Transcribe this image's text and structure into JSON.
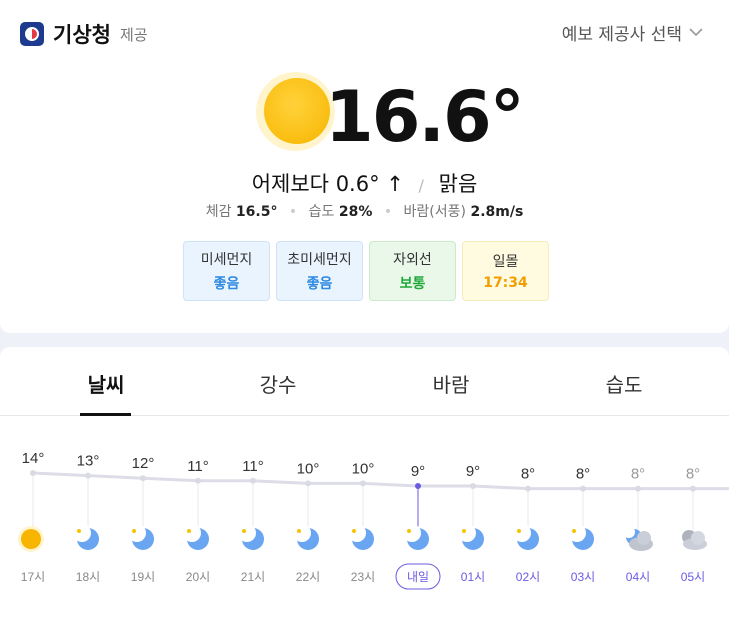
{
  "header": {
    "brand_name": "기상청",
    "brand_sub": "제공",
    "provider_label": "예보 제공사 선택"
  },
  "current": {
    "temperature": "16.6°",
    "compare_prefix": "어제보다",
    "compare_value": "0.6° ↑",
    "condition": "맑음",
    "feels_label": "체감",
    "feels_value": "16.5°",
    "humidity_label": "습도",
    "humidity_value": "28%",
    "wind_label": "바람(서풍)",
    "wind_value": "2.8m/s"
  },
  "badges": [
    {
      "label": "미세먼지",
      "value": "좋음",
      "color": "#2f8ae0"
    },
    {
      "label": "초미세먼지",
      "value": "좋음",
      "color": "#2f8ae0"
    },
    {
      "label": "자외선",
      "value": "보통",
      "color": "#1fa83a"
    },
    {
      "label": "일몰",
      "value": "17:34",
      "color": "#f29d00"
    }
  ],
  "tabs": [
    {
      "label": "날씨",
      "active": true
    },
    {
      "label": "강수",
      "active": false
    },
    {
      "label": "바람",
      "active": false
    },
    {
      "label": "습도",
      "active": false
    }
  ],
  "chart_data": {
    "type": "line",
    "categories": [
      "17시",
      "18시",
      "19시",
      "20시",
      "21시",
      "22시",
      "23시",
      "내일",
      "01시",
      "02시",
      "03시",
      "04시",
      "05시"
    ],
    "values": [
      14,
      13,
      12,
      11,
      11,
      10,
      10,
      9,
      9,
      8,
      8,
      8,
      8
    ],
    "labels": [
      "14°",
      "13°",
      "12°",
      "11°",
      "11°",
      "10°",
      "10°",
      "9°",
      "9°",
      "8°",
      "8°",
      "8°",
      "8°"
    ],
    "icons": [
      "sun-icon",
      "moon-icon",
      "moon-icon",
      "moon-icon",
      "moon-icon",
      "moon-icon",
      "moon-icon",
      "moon-icon",
      "moon-icon",
      "moon-icon",
      "moon-icon",
      "cloud-moon-icon",
      "cloud-icon"
    ],
    "highlight_index": 7,
    "tomorrow_start_index": 7,
    "line_color": "#dcdde6",
    "highlight_color": "#6a5be2"
  }
}
